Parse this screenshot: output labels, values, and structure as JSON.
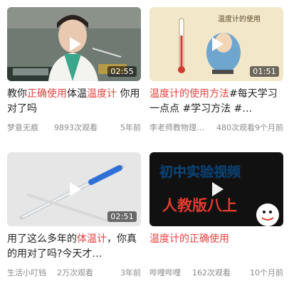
{
  "videos": [
    {
      "title_parts": [
        {
          "text": "教你",
          "hl": false
        },
        {
          "text": "正确使用",
          "hl": true
        },
        {
          "text": "体温",
          "hl": false
        },
        {
          "text": "温度计",
          "hl": true
        },
        {
          "text": " 你用对了吗",
          "hl": false
        }
      ],
      "duration": "02:55",
      "author": "梦意无痕",
      "views": "9893次观看",
      "age": "5年前",
      "thumb_caption": ""
    },
    {
      "title_parts": [
        {
          "text": "温度计的使用方法",
          "hl": true
        },
        {
          "text": "#每天学习一点点 #学习方法 #…",
          "hl": false
        }
      ],
      "duration": "01:51",
      "author": "李老师教物理…",
      "views": "480次观看",
      "age": "9个月前",
      "thumb_caption": "温度计的使用"
    },
    {
      "title_parts": [
        {
          "text": "用了这么多年的",
          "hl": false
        },
        {
          "text": "体温计",
          "hl": true
        },
        {
          "text": "，你真的用对了吗?今天才…",
          "hl": false
        }
      ],
      "duration": "02:51",
      "author": "生活小叮铛",
      "views": "2万次观看",
      "age": "3年前",
      "thumb_caption": ""
    },
    {
      "title_parts": [
        {
          "text": "温度计的正确使用",
          "hl": true
        }
      ],
      "duration": "",
      "author": "哔哩哔哩",
      "views": "162次观看",
      "age": "10个月前",
      "thumb_caption": "初中实验视频",
      "thumb_caption2": "人教版八上"
    }
  ]
}
